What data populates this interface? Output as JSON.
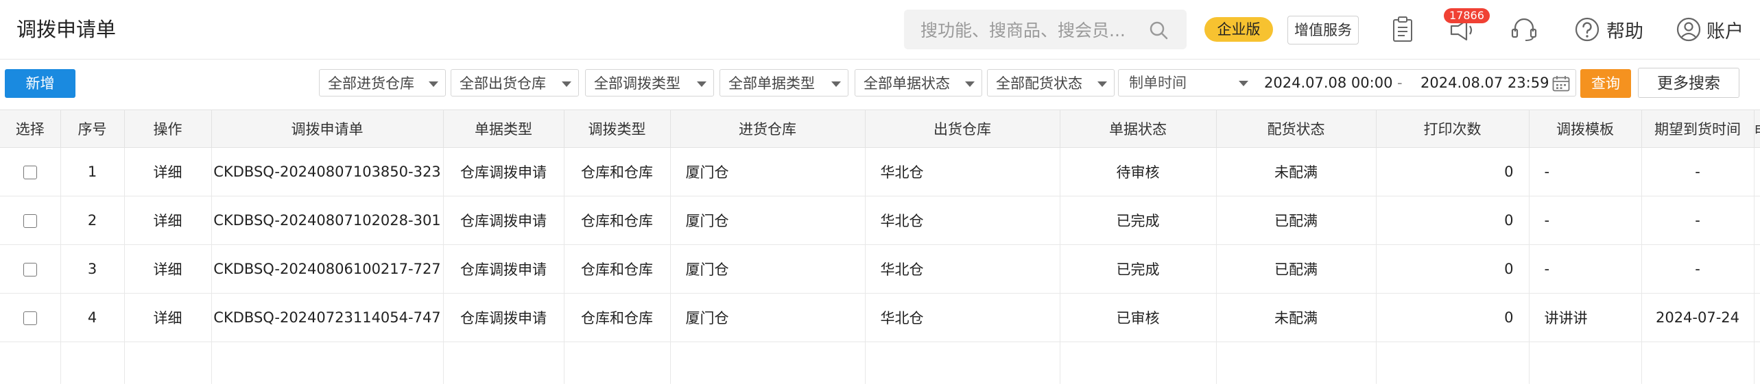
{
  "header": {
    "title": "调拨申请单",
    "search_placeholder": "搜功能、搜商品、搜会员...",
    "edition_label": "企业版",
    "value_added_label": "增值服务",
    "notification_count": "17866",
    "help_label": "帮助",
    "account_label": "账户"
  },
  "toolbar": {
    "new_label": "新增",
    "filters": [
      "全部进货仓库",
      "全部出货仓库",
      "全部调拨类型",
      "全部单据类型",
      "全部单据状态",
      "全部配货状态"
    ],
    "date_label": "制单时间",
    "date_start": "2024.07.08 00:00",
    "date_separator": "-",
    "date_end": "2024.08.07 23:59",
    "query_label": "查询",
    "more_search_label": "更多搜索"
  },
  "table": {
    "columns": [
      "选择",
      "序号",
      "操作",
      "调拨申请单",
      "单据类型",
      "调拨类型",
      "进货仓库",
      "出货仓库",
      "单据状态",
      "配货状态",
      "打印次数",
      "调拨模板",
      "期望到货时间",
      "申请"
    ],
    "rows": [
      {
        "index": "1",
        "action": "详细",
        "order_no": "CKDBSQ-20240807103850-323",
        "doc_type": "仓库调拨申请",
        "transfer_type": "仓库和仓库",
        "in_wh": "厦门仓",
        "out_wh": "华北仓",
        "doc_status": "待审核",
        "dist_status": "未配满",
        "print_count": "0",
        "template": "-",
        "expected": "-"
      },
      {
        "index": "2",
        "action": "详细",
        "order_no": "CKDBSQ-20240807102028-301",
        "doc_type": "仓库调拨申请",
        "transfer_type": "仓库和仓库",
        "in_wh": "厦门仓",
        "out_wh": "华北仓",
        "doc_status": "已完成",
        "dist_status": "已配满",
        "print_count": "0",
        "template": "-",
        "expected": "-"
      },
      {
        "index": "3",
        "action": "详细",
        "order_no": "CKDBSQ-20240806100217-727",
        "doc_type": "仓库调拨申请",
        "transfer_type": "仓库和仓库",
        "in_wh": "厦门仓",
        "out_wh": "华北仓",
        "doc_status": "已完成",
        "dist_status": "已配满",
        "print_count": "0",
        "template": "-",
        "expected": "-"
      },
      {
        "index": "4",
        "action": "详细",
        "order_no": "CKDBSQ-20240723114054-747",
        "doc_type": "仓库调拨申请",
        "transfer_type": "仓库和仓库",
        "in_wh": "厦门仓",
        "out_wh": "华北仓",
        "doc_status": "已审核",
        "dist_status": "未配满",
        "print_count": "0",
        "template": "讲讲讲",
        "expected": "2024-07-24"
      }
    ]
  },
  "colors": {
    "primary": "#1a8ae0",
    "query": "#f5921f",
    "edition": "#f7c230",
    "badge": "#f04134"
  },
  "icons": [
    "search-icon",
    "clipboard-icon",
    "announcement-icon",
    "headset-icon",
    "help-icon",
    "user-icon",
    "calendar-icon",
    "chevron-down-icon"
  ]
}
